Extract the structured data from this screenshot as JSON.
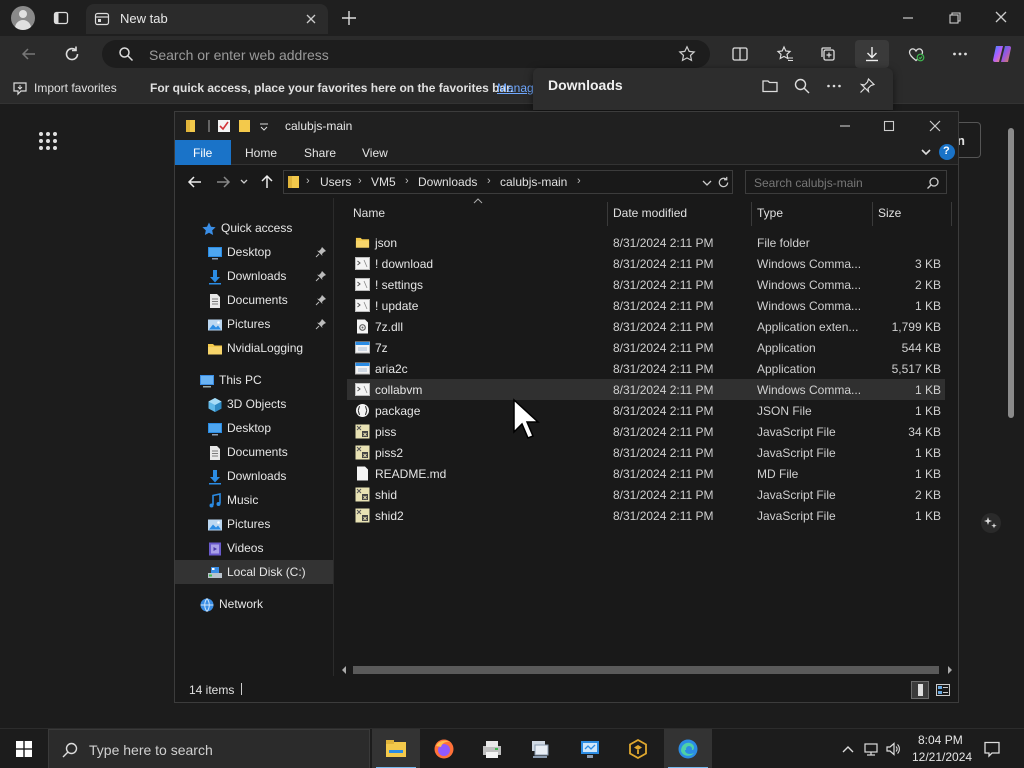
{
  "browser": {
    "tab_title": "New tab",
    "address_placeholder": "Search or enter web address",
    "favorites_bar": {
      "import_label": "Import favorites",
      "hint_text": "For quick access, place your favorites here on the favorites bar.",
      "manage_link": "Manag"
    },
    "downloads_panel": {
      "title": "Downloads"
    },
    "ntp_signin_partial": "n"
  },
  "explorer": {
    "title": "calubjs-main",
    "ribbon_tabs": {
      "file": "File",
      "home": "Home",
      "share": "Share",
      "view": "View"
    },
    "breadcrumb": [
      "Users",
      "VM5",
      "Downloads",
      "calubjs-main"
    ],
    "search_placeholder": "Search calubjs-main",
    "nav_pane": [
      {
        "label": "Quick access",
        "icon": "star-icon",
        "pinned": false
      },
      {
        "label": "Desktop",
        "icon": "desktop-icon",
        "pinned": true
      },
      {
        "label": "Downloads",
        "icon": "download-arrow-icon",
        "pinned": true
      },
      {
        "label": "Documents",
        "icon": "documents-icon",
        "pinned": true
      },
      {
        "label": "Pictures",
        "icon": "pictures-icon",
        "pinned": true
      },
      {
        "label": "NvidiaLogging",
        "icon": "folder-icon",
        "pinned": false
      },
      {
        "label": "This PC",
        "icon": "computer-icon",
        "pinned": false
      },
      {
        "label": "3D Objects",
        "icon": "cube-icon",
        "pinned": false
      },
      {
        "label": "Desktop",
        "icon": "desktop-icon",
        "pinned": false
      },
      {
        "label": "Documents",
        "icon": "documents-icon",
        "pinned": false
      },
      {
        "label": "Downloads",
        "icon": "download-arrow-icon",
        "pinned": false
      },
      {
        "label": "Music",
        "icon": "music-icon",
        "pinned": false
      },
      {
        "label": "Pictures",
        "icon": "pictures-icon",
        "pinned": false
      },
      {
        "label": "Videos",
        "icon": "videos-icon",
        "pinned": false
      },
      {
        "label": "Local Disk (C:)",
        "icon": "drive-icon",
        "pinned": false,
        "selected": true
      },
      {
        "label": "Network",
        "icon": "network-icon",
        "pinned": false
      }
    ],
    "columns": {
      "name": "Name",
      "date": "Date modified",
      "type": "Type",
      "size": "Size"
    },
    "files": [
      {
        "name": "json",
        "date": "8/31/2024 2:11 PM",
        "type": "File folder",
        "size": "",
        "icon": "folder-icon"
      },
      {
        "name": "! download",
        "date": "8/31/2024 2:11 PM",
        "type": "Windows Comma...",
        "size": "3 KB",
        "icon": "cmd-file-icon"
      },
      {
        "name": "! settings",
        "date": "8/31/2024 2:11 PM",
        "type": "Windows Comma...",
        "size": "2 KB",
        "icon": "cmd-file-icon"
      },
      {
        "name": "! update",
        "date": "8/31/2024 2:11 PM",
        "type": "Windows Comma...",
        "size": "1 KB",
        "icon": "cmd-file-icon"
      },
      {
        "name": "7z.dll",
        "date": "8/31/2024 2:11 PM",
        "type": "Application exten...",
        "size": "1,799 KB",
        "icon": "dll-file-icon"
      },
      {
        "name": "7z",
        "date": "8/31/2024 2:11 PM",
        "type": "Application",
        "size": "544 KB",
        "icon": "app-file-icon"
      },
      {
        "name": "aria2c",
        "date": "8/31/2024 2:11 PM",
        "type": "Application",
        "size": "5,517 KB",
        "icon": "app-file-icon"
      },
      {
        "name": "collabvm",
        "date": "8/31/2024 2:11 PM",
        "type": "Windows Comma...",
        "size": "1 KB",
        "icon": "cmd-file-icon",
        "hover": true
      },
      {
        "name": "package",
        "date": "8/31/2024 2:11 PM",
        "type": "JSON File",
        "size": "1 KB",
        "icon": "json-file-icon"
      },
      {
        "name": "piss",
        "date": "8/31/2024 2:11 PM",
        "type": "JavaScript File",
        "size": "34 KB",
        "icon": "js-file-icon"
      },
      {
        "name": "piss2",
        "date": "8/31/2024 2:11 PM",
        "type": "JavaScript File",
        "size": "1 KB",
        "icon": "js-file-icon"
      },
      {
        "name": "README.md",
        "date": "8/31/2024 2:11 PM",
        "type": "MD File",
        "size": "1 KB",
        "icon": "text-file-icon"
      },
      {
        "name": "shid",
        "date": "8/31/2024 2:11 PM",
        "type": "JavaScript File",
        "size": "2 KB",
        "icon": "js-file-icon"
      },
      {
        "name": "shid2",
        "date": "8/31/2024 2:11 PM",
        "type": "JavaScript File",
        "size": "1 KB",
        "icon": "js-file-icon"
      }
    ],
    "status_count": "14 items"
  },
  "taskbar": {
    "search_placeholder": "Type here to search",
    "apps": [
      "file-explorer-icon",
      "firefox-icon",
      "printer-app-icon",
      "network-app-icon",
      "remote-desktop-icon",
      "cube-app-icon",
      "edge-icon"
    ],
    "time": "8:04 PM",
    "date": "12/21/2024"
  },
  "colors": {
    "accent": "#1a73c8",
    "folder": "#f3c94b",
    "edge_blue": "#2b8ce4"
  }
}
